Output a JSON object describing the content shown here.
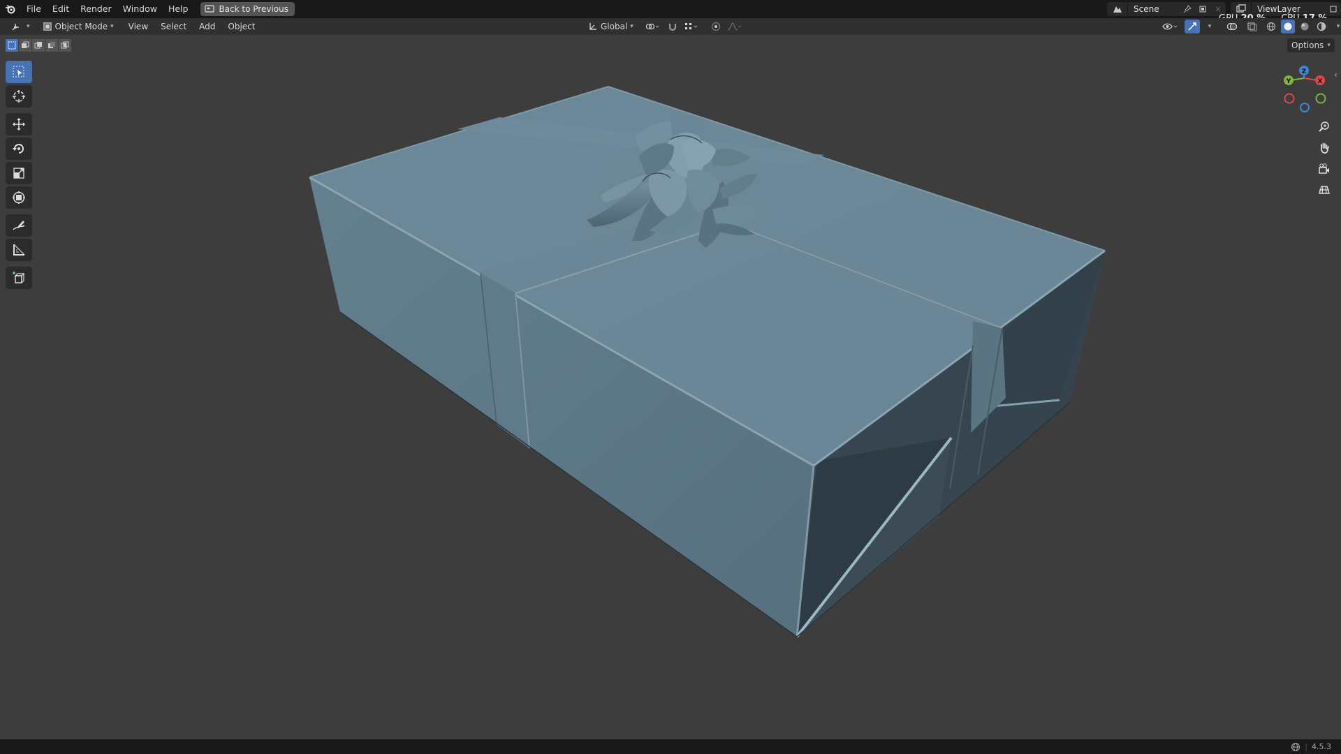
{
  "menu": {
    "items": [
      "File",
      "Edit",
      "Render",
      "Window",
      "Help"
    ],
    "back_label": "Back to Previous"
  },
  "scene": {
    "name": "Scene"
  },
  "view_layer": {
    "name": "ViewLayer"
  },
  "stats": {
    "gpu_label": "GPU",
    "gpu_value": "20 %",
    "cpu_label": "CPU",
    "cpu_value": "17 %"
  },
  "header": {
    "mode": "Object Mode",
    "menus": [
      "View",
      "Select",
      "Add",
      "Object"
    ],
    "orientation": "Global"
  },
  "options_label": "Options",
  "status": {
    "version": "4.5.3"
  },
  "colors": {
    "accent": "#4772b3",
    "object_top": "#6e8a9a",
    "object_front": "#5f7a89",
    "object_side": "#3b4a55",
    "axis_x": "#e0464a",
    "axis_y": "#7fb33a",
    "axis_z": "#3e86d6"
  },
  "icons": {
    "tools": [
      "select-box-icon",
      "cursor-icon",
      "move-icon",
      "rotate-icon",
      "scale-icon",
      "transform-icon",
      "annotate-icon",
      "measure-icon",
      "add-cube-icon"
    ],
    "nav": [
      "zoom-icon",
      "pan-hand-icon",
      "camera-icon",
      "grid-view-icon"
    ]
  },
  "gizmo": {
    "x": "X",
    "y": "Y",
    "z": "Z"
  }
}
